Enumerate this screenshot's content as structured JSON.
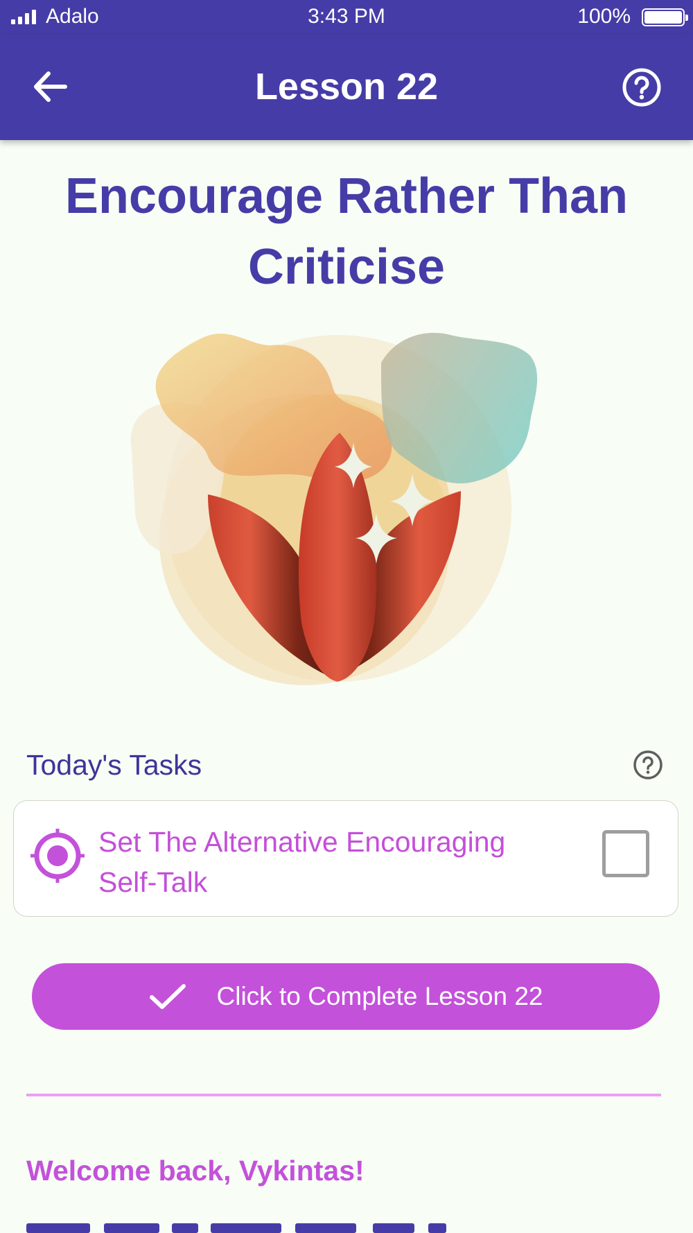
{
  "status_bar": {
    "carrier": "Adalo",
    "time": "3:43 PM",
    "battery": "100%"
  },
  "header": {
    "title": "Lesson 22",
    "back_icon": "arrow-left-icon",
    "help_icon": "help-circle-icon"
  },
  "lesson": {
    "title": "Encourage Rather Than Criticise"
  },
  "tasks": {
    "heading": "Today's Tasks",
    "items": [
      {
        "label": "Set The Alternative Encouraging Self-Talk",
        "icon": "target-icon",
        "checked": false
      }
    ]
  },
  "complete_button": {
    "label": "Click to Complete Lesson 22",
    "icon": "check-icon"
  },
  "welcome": "Welcome back, Vykintas!",
  "colors": {
    "primary": "#463ca7",
    "accent": "#c351da",
    "background": "#f8fdf6"
  }
}
